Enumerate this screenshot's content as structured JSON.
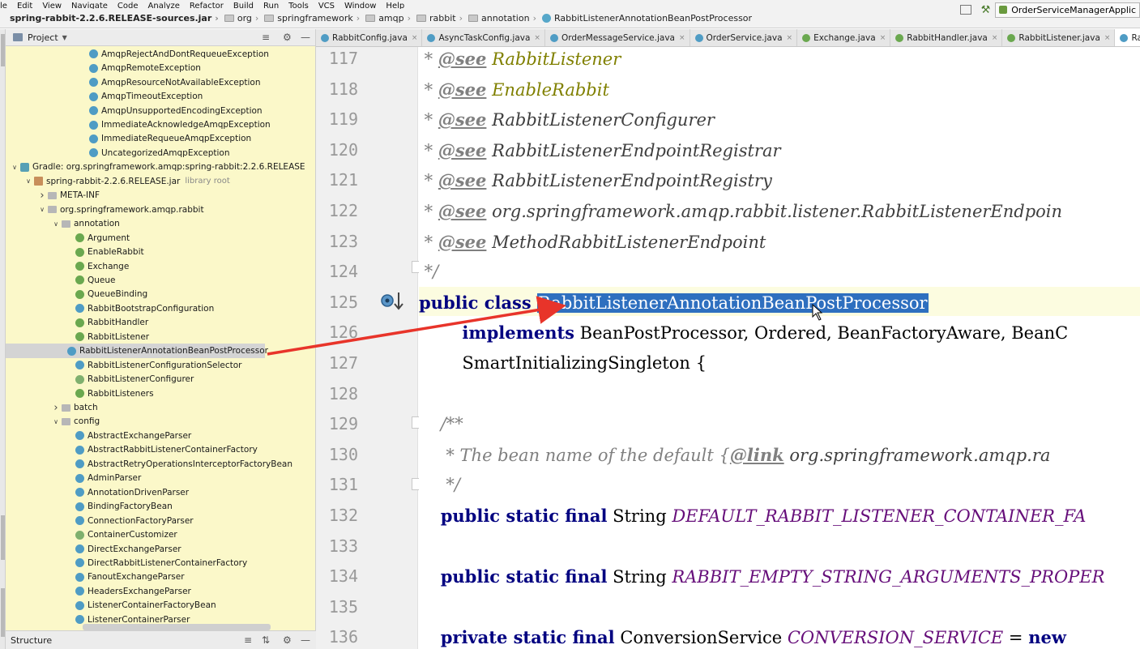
{
  "menu": [
    "le",
    "Edit",
    "View",
    "Navigate",
    "Code",
    "Analyze",
    "Refactor",
    "Build",
    "Run",
    "Tools",
    "VCS",
    "Window",
    "Help"
  ],
  "breadcrumb": [
    "spring-rabbit-2.2.6.RELEASE-sources.jar",
    "org",
    "springframework",
    "amqp",
    "rabbit",
    "annotation",
    "RabbitListenerAnnotationBeanPostProcessor"
  ],
  "run_config": "OrderServiceManagerApplic",
  "project_panel": {
    "title": "Project"
  },
  "structure_panel": {
    "title": "Structure"
  },
  "tree": [
    {
      "label": "AmqpRejectAndDontRequeueException",
      "icon": "class",
      "indent": 5
    },
    {
      "label": "AmqpRemoteException",
      "icon": "class",
      "indent": 5
    },
    {
      "label": "AmqpResourceNotAvailableException",
      "icon": "class",
      "indent": 5
    },
    {
      "label": "AmqpTimeoutException",
      "icon": "class",
      "indent": 5
    },
    {
      "label": "AmqpUnsupportedEncodingException",
      "icon": "class",
      "indent": 5
    },
    {
      "label": "ImmediateAcknowledgeAmqpException",
      "icon": "class",
      "indent": 5
    },
    {
      "label": "ImmediateRequeueAmqpException",
      "icon": "class",
      "indent": 5
    },
    {
      "label": "UncategorizedAmqpException",
      "icon": "class",
      "indent": 5
    },
    {
      "label": "Gradle: org.springframework.amqp:spring-rabbit:2.2.6.RELEASE",
      "icon": "gradle",
      "indent": 0,
      "arrow": "open"
    },
    {
      "label": "spring-rabbit-2.2.6.RELEASE.jar",
      "icon": "jar",
      "indent": 1,
      "arrow": "open",
      "note": "library root"
    },
    {
      "label": "META-INF",
      "icon": "folder",
      "indent": 2,
      "arrow": "closed"
    },
    {
      "label": "org.springframework.amqp.rabbit",
      "icon": "folder",
      "indent": 2,
      "arrow": "open"
    },
    {
      "label": "annotation",
      "icon": "folder",
      "indent": 3,
      "arrow": "open"
    },
    {
      "label": "Argument",
      "icon": "annotation",
      "indent": 4
    },
    {
      "label": "EnableRabbit",
      "icon": "annotation",
      "indent": 4
    },
    {
      "label": "Exchange",
      "icon": "annotation",
      "indent": 4
    },
    {
      "label": "Queue",
      "icon": "annotation",
      "indent": 4
    },
    {
      "label": "QueueBinding",
      "icon": "annotation",
      "indent": 4
    },
    {
      "label": "RabbitBootstrapConfiguration",
      "icon": "class",
      "indent": 4
    },
    {
      "label": "RabbitHandler",
      "icon": "annotation",
      "indent": 4
    },
    {
      "label": "RabbitListener",
      "icon": "annotation",
      "indent": 4
    },
    {
      "label": "RabbitListenerAnnotationBeanPostProcessor",
      "icon": "class",
      "indent": 4,
      "selected": true
    },
    {
      "label": "RabbitListenerConfigurationSelector",
      "icon": "class",
      "indent": 4
    },
    {
      "label": "RabbitListenerConfigurer",
      "icon": "interface",
      "indent": 4
    },
    {
      "label": "RabbitListeners",
      "icon": "annotation",
      "indent": 4
    },
    {
      "label": "batch",
      "icon": "folder",
      "indent": 3,
      "arrow": "closed"
    },
    {
      "label": "config",
      "icon": "folder",
      "indent": 3,
      "arrow": "open"
    },
    {
      "label": "AbstractExchangeParser",
      "icon": "class",
      "indent": 4
    },
    {
      "label": "AbstractRabbitListenerContainerFactory",
      "icon": "class",
      "indent": 4
    },
    {
      "label": "AbstractRetryOperationsInterceptorFactoryBean",
      "icon": "class",
      "indent": 4
    },
    {
      "label": "AdminParser",
      "icon": "class",
      "indent": 4
    },
    {
      "label": "AnnotationDrivenParser",
      "icon": "class",
      "indent": 4
    },
    {
      "label": "BindingFactoryBean",
      "icon": "class",
      "indent": 4
    },
    {
      "label": "ConnectionFactoryParser",
      "icon": "class",
      "indent": 4
    },
    {
      "label": "ContainerCustomizer",
      "icon": "interface",
      "indent": 4
    },
    {
      "label": "DirectExchangeParser",
      "icon": "class",
      "indent": 4
    },
    {
      "label": "DirectRabbitListenerContainerFactory",
      "icon": "class",
      "indent": 4
    },
    {
      "label": "FanoutExchangeParser",
      "icon": "class",
      "indent": 4
    },
    {
      "label": "HeadersExchangeParser",
      "icon": "class",
      "indent": 4
    },
    {
      "label": "ListenerContainerFactoryBean",
      "icon": "class",
      "indent": 4
    },
    {
      "label": "ListenerContainerParser",
      "icon": "class",
      "indent": 4
    }
  ],
  "tabs": [
    {
      "label": "RabbitConfig.java",
      "icon": "class"
    },
    {
      "label": "AsyncTaskConfig.java",
      "icon": "class"
    },
    {
      "label": "OrderMessageService.java",
      "icon": "class"
    },
    {
      "label": "OrderService.java",
      "icon": "class"
    },
    {
      "label": "Exchange.java",
      "icon": "annotation"
    },
    {
      "label": "RabbitHandler.java",
      "icon": "annotation"
    },
    {
      "label": "RabbitListener.java",
      "icon": "annotation"
    },
    {
      "label": "RabbitListen",
      "icon": "class",
      "active": true
    }
  ],
  "line_numbers": [
    "117",
    "118",
    "119",
    "120",
    "121",
    "122",
    "123",
    "124",
    "125",
    "126",
    "127",
    "128",
    "129",
    "130",
    "131",
    "132",
    "133",
    "134",
    "135",
    "136"
  ],
  "code": {
    "l117": {
      "star": " * ",
      "tag": "@see",
      "ref": "RabbitListener"
    },
    "l118": {
      "star": " * ",
      "tag": "@see",
      "ref": "EnableRabbit"
    },
    "l119": {
      "star": " * ",
      "tag": "@see",
      "ref": "RabbitListenerConfigurer"
    },
    "l120": {
      "star": " * ",
      "tag": "@see",
      "ref": "RabbitListenerEndpointRegistrar"
    },
    "l121": {
      "star": " * ",
      "tag": "@see",
      "ref": "RabbitListenerEndpointRegistry"
    },
    "l122": {
      "star": " * ",
      "tag": "@see",
      "ref": "org.springframework.amqp.rabbit.listener.RabbitListenerEndpoin"
    },
    "l123": {
      "star": " * ",
      "tag": "@see",
      "ref": "MethodRabbitListenerEndpoint"
    },
    "l124": {
      "text": " */"
    },
    "l125": {
      "kw": "public class ",
      "selected": "RabbitListenerAnnotationBeanPostProcessor"
    },
    "l126": {
      "indent": "        ",
      "kw": "implements",
      "rest": " BeanPostProcessor, Ordered, BeanFactoryAware, BeanC"
    },
    "l127": {
      "text": "        SmartInitializingSingleton {"
    },
    "l129": {
      "text": "    /**"
    },
    "l130": {
      "text": "     * The bean name of the default ",
      "brace": "{",
      "tag": "@link",
      "rest": " org.springframework.amqp.ra"
    },
    "l131": {
      "text": "     */"
    },
    "l132": {
      "indent": "    ",
      "kw": "public static final",
      "type": " String ",
      "const": "DEFAULT_RABBIT_LISTENER_CONTAINER_FA"
    },
    "l134": {
      "indent": "    ",
      "kw": "public static final",
      "type": " String ",
      "const": "RABBIT_EMPTY_STRING_ARGUMENTS_PROPER"
    },
    "l136": {
      "indent": "    ",
      "kw": "private static final",
      "type": " ConversionService ",
      "const": "CONVERSION_SERVICE",
      "eq": " = ",
      "kw2": "new"
    }
  },
  "colors": {
    "project_bg": "#fbf8c9",
    "selection": "#2e6fbf",
    "annotation_arrow": "#e8342a"
  }
}
